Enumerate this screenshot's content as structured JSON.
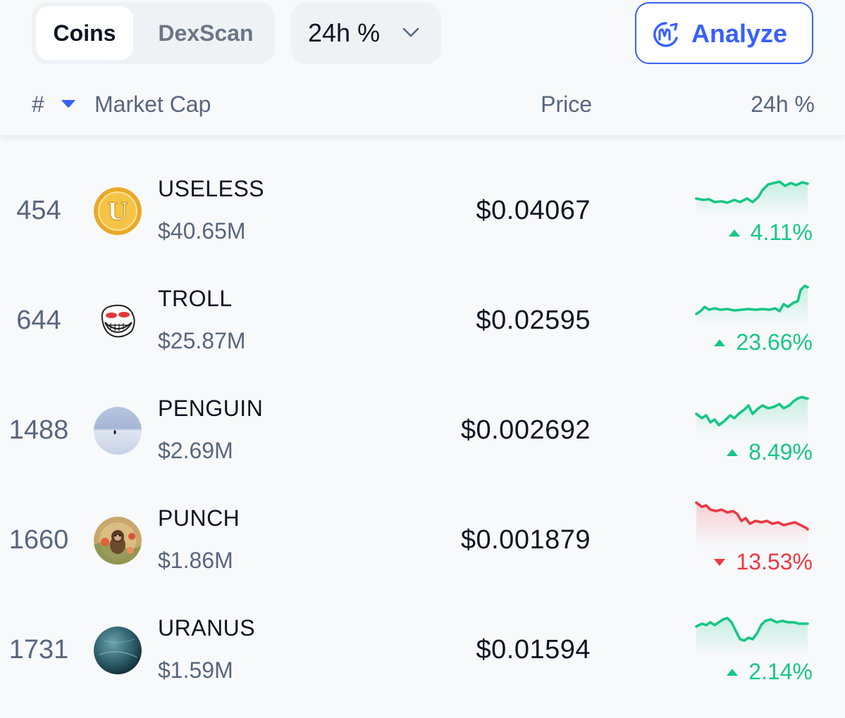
{
  "tabs": {
    "coins_label": "Coins",
    "dexscan_label": "DexScan"
  },
  "timeframe": {
    "selected": "24h %"
  },
  "analyze": {
    "label": "Analyze"
  },
  "columns": {
    "rank": "#",
    "market_cap": "Market Cap",
    "price": "Price",
    "change": "24h %"
  },
  "colors": {
    "accent": "#3861fb",
    "positive": "#16c784",
    "negative": "#ea3943",
    "muted_text": "#58667e"
  },
  "coins": [
    {
      "rank": "454",
      "name": "USELESS",
      "market_cap": "$40.65M",
      "price": "$0.04067",
      "change": "4.11%",
      "direction": "up",
      "logo": "useless-coin-icon"
    },
    {
      "rank": "644",
      "name": "TROLL",
      "market_cap": "$25.87M",
      "price": "$0.02595",
      "change": "23.66%",
      "direction": "up",
      "logo": "troll-face-icon"
    },
    {
      "rank": "1488",
      "name": "PENGUIN",
      "market_cap": "$2.69M",
      "price": "$0.002692",
      "change": "8.49%",
      "direction": "up",
      "logo": "penguin-snow-icon"
    },
    {
      "rank": "1660",
      "name": "PUNCH",
      "market_cap": "$1.86M",
      "price": "$0.001879",
      "change": "13.53%",
      "direction": "down",
      "logo": "punch-monkey-icon"
    },
    {
      "rank": "1731",
      "name": "URANUS",
      "market_cap": "$1.59M",
      "price": "$0.01594",
      "change": "2.14%",
      "direction": "up",
      "logo": "uranus-planet-icon"
    }
  ]
}
